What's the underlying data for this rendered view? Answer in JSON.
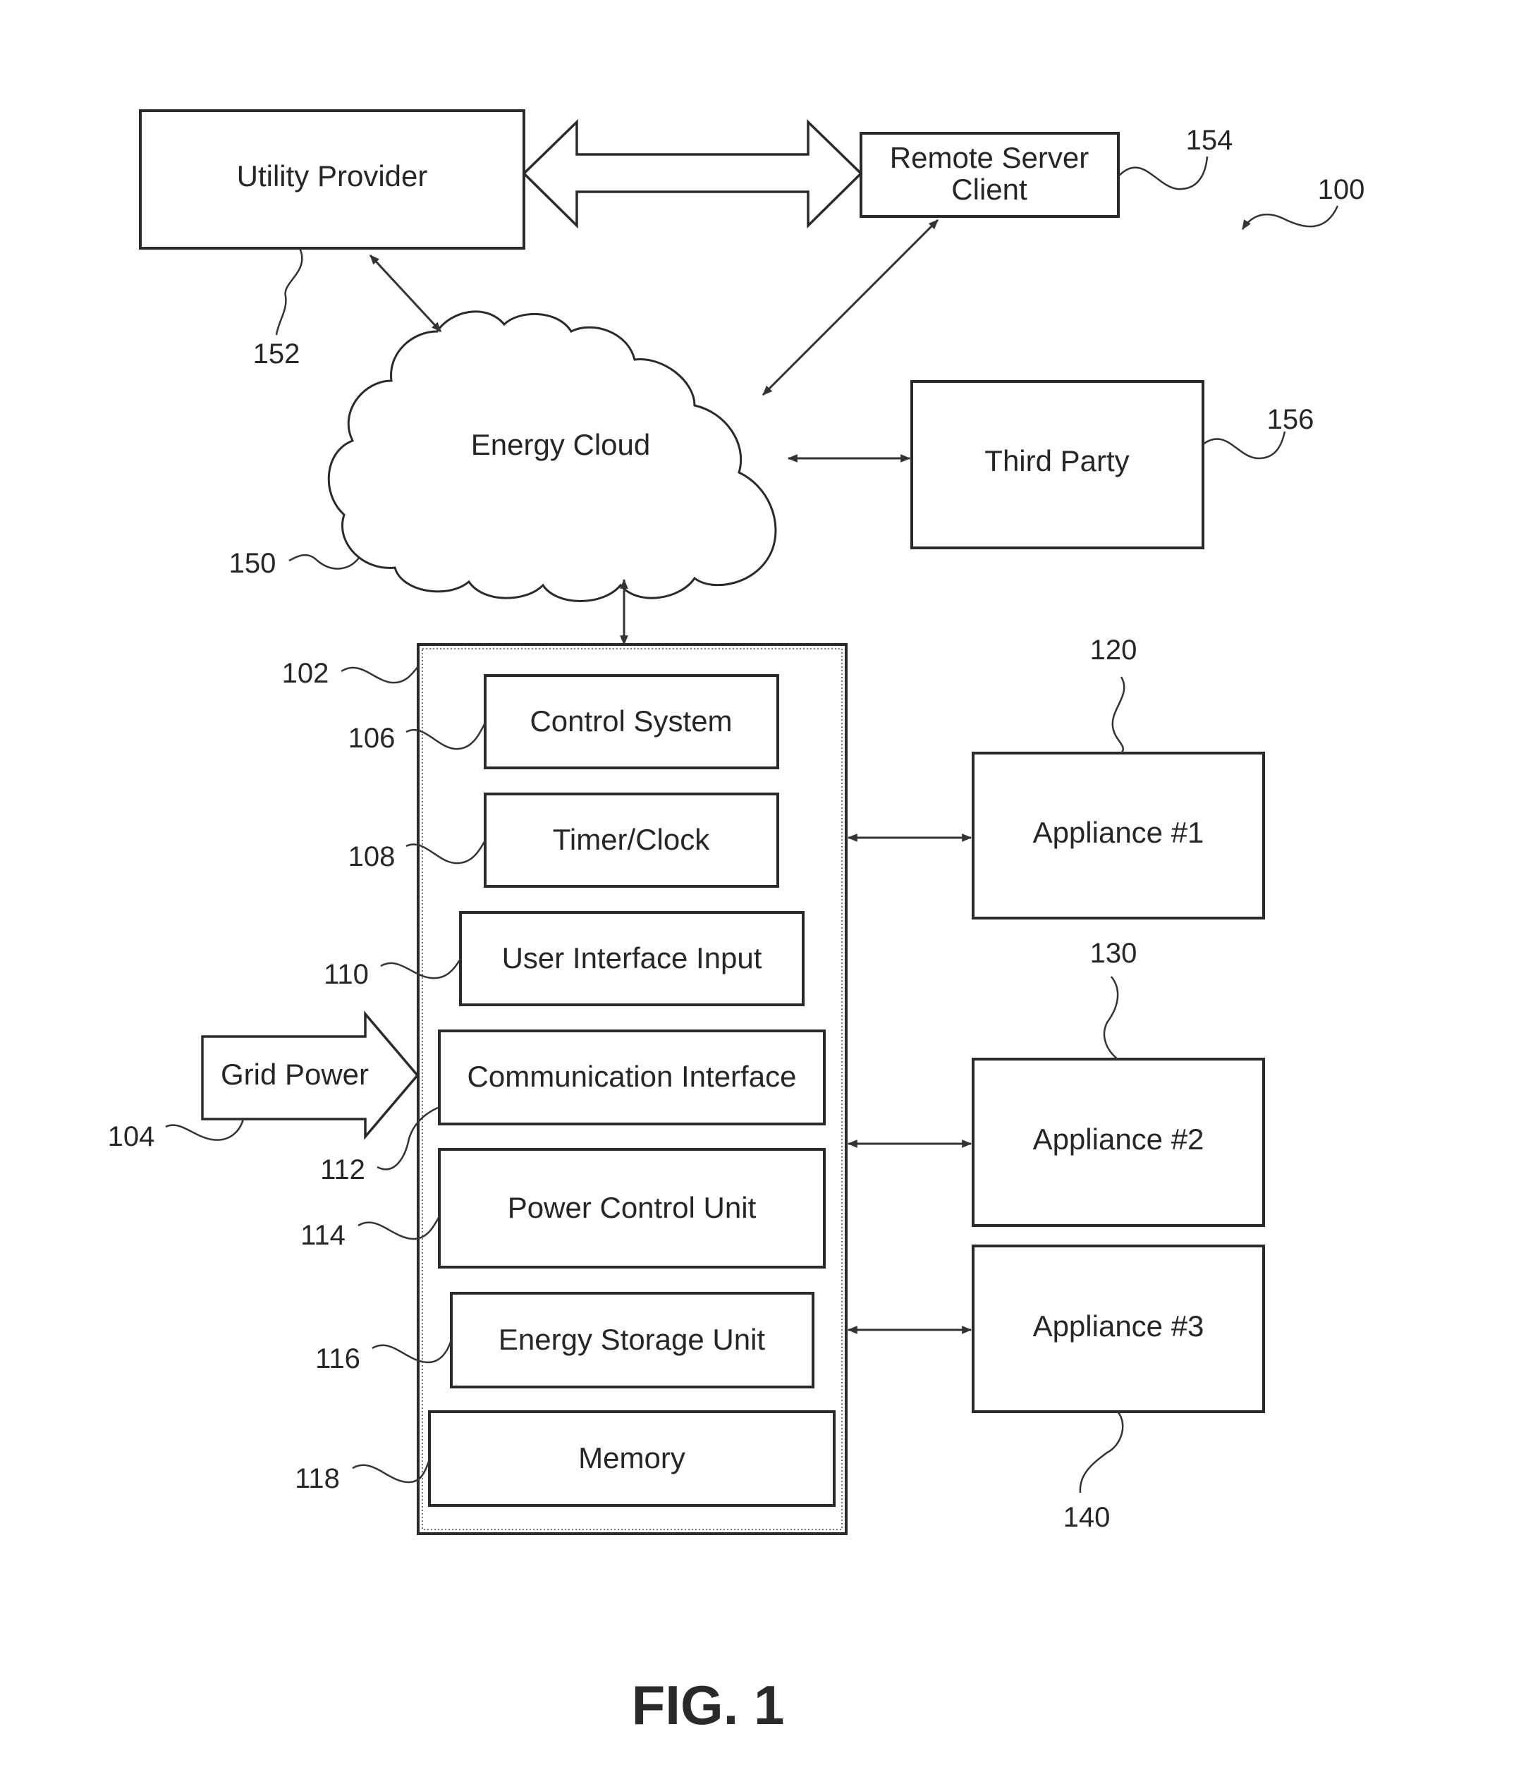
{
  "figure": {
    "caption": "FIG. 1",
    "system_ref": "100"
  },
  "external": {
    "utility_provider": {
      "label": "Utility Provider",
      "ref": "152"
    },
    "remote_server": {
      "label_line1": "Remote Server",
      "label_line2": "Client",
      "ref": "154"
    },
    "energy_cloud": {
      "label": "Energy Cloud",
      "ref": "150"
    },
    "third_party": {
      "label": "Third Party",
      "ref": "156"
    }
  },
  "controller": {
    "ref": "102",
    "modules": [
      {
        "label": "Control System",
        "ref": "106"
      },
      {
        "label": "Timer/Clock",
        "ref": "108"
      },
      {
        "label": "User Interface Input",
        "ref": "110"
      },
      {
        "label": "Communication Interface",
        "ref": "112"
      },
      {
        "label": "Power Control Unit",
        "ref": "114"
      },
      {
        "label": "Energy Storage Unit",
        "ref": "116"
      },
      {
        "label": "Memory",
        "ref": "118"
      }
    ]
  },
  "grid_power": {
    "label": "Grid Power",
    "ref": "104"
  },
  "appliances": [
    {
      "label": "Appliance #1",
      "ref": "120"
    },
    {
      "label": "Appliance #2",
      "ref": "130"
    },
    {
      "label": "Appliance #3",
      "ref": "140"
    }
  ]
}
